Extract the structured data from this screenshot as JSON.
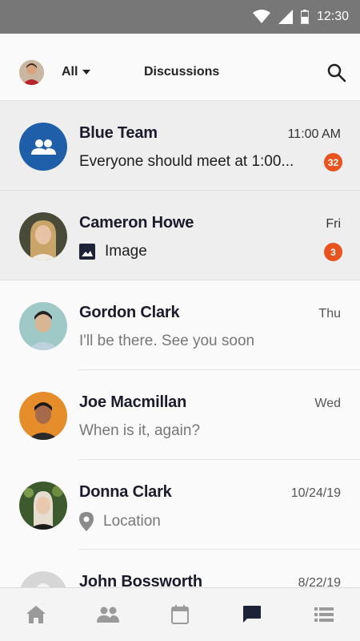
{
  "status_bar": {
    "time": "12:30",
    "icons": [
      "wifi-icon",
      "cell-signal-icon",
      "battery-icon"
    ]
  },
  "header": {
    "filter_label": "All",
    "title": "Discussions",
    "search_icon": "search-icon"
  },
  "conversations": [
    {
      "name": "Blue Team",
      "time": "11:00 AM",
      "preview": "Everyone should meet at 1:00...",
      "unread_count": "32",
      "avatar": "group-icon"
    },
    {
      "name": "Cameron Howe",
      "time": "Fri",
      "preview": "Image",
      "preview_icon": "image-icon",
      "unread_count": "3"
    },
    {
      "name": "Gordon Clark",
      "time": "Thu",
      "preview": "I'll be there. See you soon"
    },
    {
      "name": "Joe Macmillan",
      "time": "Wed",
      "preview": "When is it, again?"
    },
    {
      "name": "Donna Clark",
      "time": "10/24/19",
      "preview": "Location",
      "preview_icon": "location-pin-icon"
    },
    {
      "name": "John Bossworth",
      "time": "8/22/19",
      "preview": ""
    }
  ],
  "bottom_nav": {
    "tabs": [
      "home-icon",
      "people-icon",
      "calendar-icon",
      "chat-icon",
      "list-icon"
    ],
    "active": "chat-icon"
  },
  "colors": {
    "accent_blue": "#1f5fa9",
    "badge_orange": "#e8531e",
    "status_bar": "#777777"
  }
}
